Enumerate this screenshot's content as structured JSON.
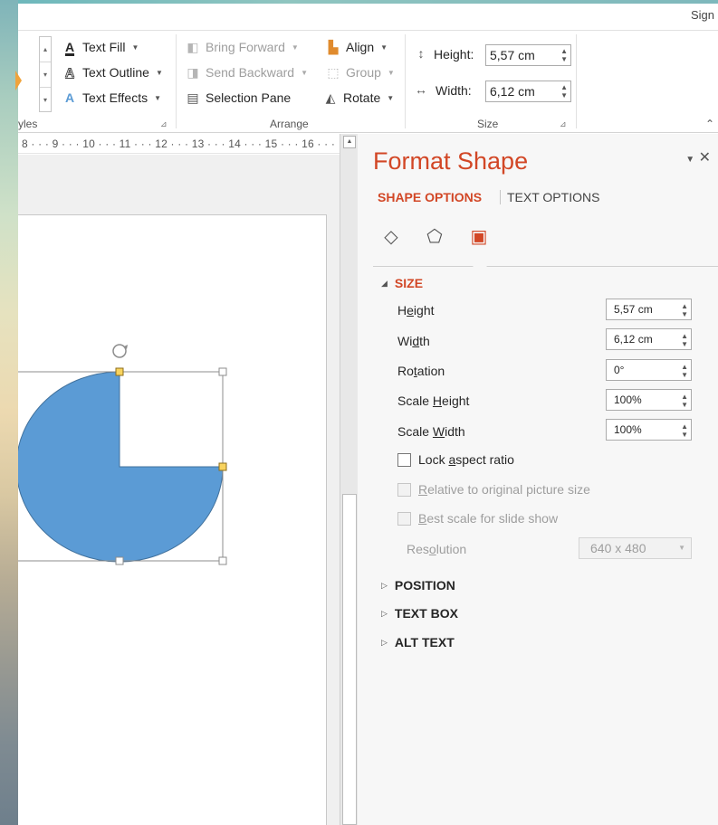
{
  "window": {
    "sign_in": "Sign"
  },
  "ribbon": {
    "styles_group": {
      "label_fragment": "yles",
      "text_fill": "Text Fill",
      "text_outline": "Text Outline",
      "text_effects": "Text Effects"
    },
    "arrange_group": {
      "label": "Arrange",
      "bring_forward": "Bring Forward",
      "send_backward": "Send Backward",
      "selection_pane": "Selection Pane",
      "align": "Align",
      "group": "Group",
      "rotate": "Rotate"
    },
    "size_group": {
      "label": "Size",
      "height_label": "Height:",
      "height_value": "5,57 cm",
      "width_label": "Width:",
      "width_value": "6,12 cm"
    }
  },
  "ruler": {
    "text": "8 · · · 9 · · · 10 · · · 11 · · · 12 · · · 13 · · · 14 · · · 15 · · · 16 · · ·"
  },
  "shape": {
    "fill_color": "#5b9bd5",
    "outline_color": "#41719c",
    "selection_color": "#8c8c8c",
    "handle_adjust_color": "#f8d35e"
  },
  "format_pane": {
    "title": "Format Shape",
    "tabs": {
      "shape_options": "SHAPE OPTIONS",
      "text_options": "TEXT OPTIONS"
    },
    "icons": [
      "fill-line-icon",
      "effects-icon",
      "size-properties-icon"
    ],
    "size_section": {
      "title": "SIZE",
      "height": {
        "pre": "H",
        "key": "e",
        "post": "ight",
        "value": "5,57 cm"
      },
      "width": {
        "pre": "Wi",
        "key": "d",
        "post": "th",
        "value": "6,12 cm"
      },
      "rotation": {
        "pre": "Ro",
        "key": "t",
        "post": "ation",
        "value": "0°"
      },
      "scale_height": {
        "pre": "Scale ",
        "key": "H",
        "post": "eight",
        "value": "100%"
      },
      "scale_width": {
        "pre": "Scale ",
        "key": "W",
        "post": "idth",
        "value": "100%"
      },
      "lock_aspect": {
        "pre": "Lock ",
        "key": "a",
        "post": "spect ratio"
      },
      "relative_original": {
        "pre": "",
        "key": "R",
        "post": "elative to original picture size"
      },
      "best_scale": {
        "pre": "",
        "key": "B",
        "post": "est scale for slide show"
      },
      "resolution": {
        "pre": "Res",
        "key": "o",
        "post": "lution",
        "value": "640 x 480"
      }
    },
    "collapsed_sections": [
      "POSITION",
      "TEXT BOX",
      "ALT TEXT"
    ]
  },
  "colors": {
    "accent": "#d24726",
    "pane_bg": "#f7f7f7"
  }
}
